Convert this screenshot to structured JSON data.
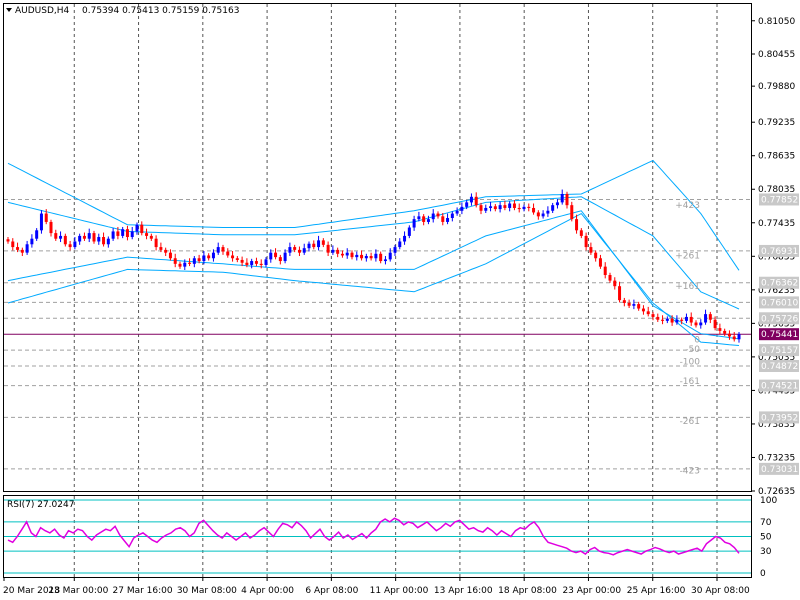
{
  "header": {
    "symbol": "AUDUSD,H4",
    "ohlc": "0.75394 0.75413 0.75159 0.75163",
    "triangle_icon": "triangle-down-icon"
  },
  "rsi": {
    "label": "RSI(7) 27.0247",
    "value": 27.0247,
    "levels": [
      "100",
      "70",
      "50",
      "30",
      "0"
    ]
  },
  "colors": {
    "bull": "#0000ff",
    "bear": "#ff0000",
    "band": "#00aaff",
    "rsi": "#e000e0",
    "rsi_level": "#00c0c0",
    "price_tag": "#800060",
    "grid": "#555555",
    "level_line": "#a0a0a0"
  },
  "chart_data": {
    "type": "candlestick",
    "ylim": [
      0.72635,
      0.8135
    ],
    "price_ticks": [
      "0.81050",
      "0.80455",
      "0.79880",
      "0.79235",
      "0.78635",
      "0.78035",
      "0.77435",
      "0.76835",
      "0.76235",
      "0.75635",
      "0.75035",
      "0.74435",
      "0.73835",
      "0.73235",
      "0.72635"
    ],
    "current_price": {
      "label": "0.75441",
      "value": 0.75441
    },
    "horizontal_levels": [
      {
        "price": 0.77852,
        "label": "0.77852",
        "fib": "+423"
      },
      {
        "price": 0.76931,
        "label": "0.76931",
        "fib": "+261"
      },
      {
        "price": 0.76362,
        "label": "0.76362",
        "fib": "+161"
      },
      {
        "price": 0.7601,
        "label": "0.76010",
        "fib": ""
      },
      {
        "price": 0.75726,
        "label": "0.75726",
        "fib": ""
      },
      {
        "price": 0.75157,
        "label": "0.75157",
        "fib": "0"
      },
      {
        "price": 0.74872,
        "label": "0.74872",
        "fib": "-50"
      },
      {
        "price": 0.74521,
        "label": "0.74521",
        "fib": "-100"
      },
      {
        "price": 0.73952,
        "label": "0.73952",
        "fib": "-261"
      },
      {
        "price": 0.73031,
        "label": "0.73031",
        "fib": "-423"
      }
    ],
    "fib_labels": [
      {
        "price": 0.7775,
        "text": "+423"
      },
      {
        "price": 0.7685,
        "text": "+261"
      },
      {
        "price": 0.763,
        "text": "+161"
      },
      {
        "price": 0.7535,
        "text": "0"
      },
      {
        "price": 0.7518,
        "text": "-50"
      },
      {
        "price": 0.7495,
        "text": "-100"
      },
      {
        "price": 0.746,
        "text": "-161"
      },
      {
        "price": 0.7389,
        "text": "-261"
      },
      {
        "price": 0.73,
        "text": "-423"
      }
    ],
    "x_labels": [
      "20 Mar 2018",
      "23 Mar 00:00",
      "27 Mar 16:00",
      "30 Mar 08:00",
      "4 Apr 00:00",
      "6 Apr 08:00",
      "11 Apr 00:00",
      "13 Apr 16:00",
      "18 Apr 08:00",
      "23 Apr 00:00",
      "25 Apr 16:00",
      "30 Apr 08:00"
    ],
    "closes": [
      0.771,
      0.77,
      0.7695,
      0.769,
      0.7705,
      0.7715,
      0.773,
      0.776,
      0.7745,
      0.7725,
      0.7715,
      0.772,
      0.7705,
      0.77,
      0.771,
      0.772,
      0.7715,
      0.7725,
      0.771,
      0.7718,
      0.7705,
      0.7715,
      0.7728,
      0.772,
      0.7732,
      0.7718,
      0.7728,
      0.774,
      0.7725,
      0.772,
      0.7715,
      0.77,
      0.7695,
      0.769,
      0.768,
      0.767,
      0.7665,
      0.7672,
      0.767,
      0.768,
      0.7675,
      0.7685,
      0.768,
      0.769,
      0.77,
      0.7692,
      0.7685,
      0.768,
      0.7677,
      0.7672,
      0.7668,
      0.7675,
      0.767,
      0.7668,
      0.7678,
      0.769,
      0.7682,
      0.7675,
      0.769,
      0.77,
      0.7695,
      0.769,
      0.7698,
      0.7706,
      0.77,
      0.7712,
      0.7704,
      0.769,
      0.7695,
      0.7688,
      0.7685,
      0.769,
      0.7682,
      0.7686,
      0.768,
      0.7684,
      0.768,
      0.7688,
      0.7675,
      0.7678,
      0.769,
      0.77,
      0.771,
      0.772,
      0.7735,
      0.775,
      0.7755,
      0.7745,
      0.775,
      0.776,
      0.7755,
      0.7745,
      0.7752,
      0.776,
      0.7765,
      0.7772,
      0.778,
      0.779,
      0.7775,
      0.7765,
      0.777,
      0.7773,
      0.7768,
      0.7775,
      0.777,
      0.7778,
      0.777,
      0.7768,
      0.7772,
      0.777,
      0.7762,
      0.7755,
      0.776,
      0.7765,
      0.7775,
      0.778,
      0.7795,
      0.7775,
      0.775,
      0.773,
      0.772,
      0.77,
      0.769,
      0.768,
      0.7665,
      0.765,
      0.764,
      0.763,
      0.7605,
      0.76,
      0.7595,
      0.7598,
      0.759,
      0.7585,
      0.758,
      0.7575,
      0.757,
      0.7568,
      0.7572,
      0.7565,
      0.757,
      0.7568,
      0.7575,
      0.7565,
      0.756,
      0.7565,
      0.758,
      0.757,
      0.7555,
      0.755,
      0.7545,
      0.754,
      0.7535,
      0.7544
    ],
    "bands": [
      {
        "name": "outer",
        "upper": [
          [
            0,
            0.785
          ],
          [
            25,
            0.774
          ],
          [
            45,
            0.7735
          ],
          [
            60,
            0.7735
          ],
          [
            85,
            0.7765
          ],
          [
            100,
            0.779
          ],
          [
            120,
            0.7795
          ],
          [
            135,
            0.7855
          ],
          [
            145,
            0.776
          ],
          [
            158,
            0.7595
          ]
        ],
        "lower": [
          [
            0,
            0.76
          ],
          [
            25,
            0.766
          ],
          [
            45,
            0.7655
          ],
          [
            60,
            0.764
          ],
          [
            85,
            0.762
          ],
          [
            100,
            0.767
          ],
          [
            120,
            0.776
          ],
          [
            135,
            0.76
          ],
          [
            145,
            0.753
          ],
          [
            158,
            0.752
          ]
        ]
      },
      {
        "name": "inner",
        "upper": [
          [
            0,
            0.778
          ],
          [
            25,
            0.7728
          ],
          [
            45,
            0.7722
          ],
          [
            60,
            0.7722
          ],
          [
            85,
            0.7745
          ],
          [
            100,
            0.778
          ],
          [
            120,
            0.779
          ],
          [
            135,
            0.772
          ],
          [
            145,
            0.762
          ],
          [
            158,
            0.757
          ]
        ],
        "lower": [
          [
            0,
            0.764
          ],
          [
            25,
            0.7682
          ],
          [
            45,
            0.767
          ],
          [
            60,
            0.766
          ],
          [
            85,
            0.766
          ],
          [
            100,
            0.772
          ],
          [
            120,
            0.7765
          ],
          [
            135,
            0.7595
          ],
          [
            145,
            0.7545
          ],
          [
            158,
            0.753
          ]
        ]
      }
    ],
    "rsi_values": [
      45,
      42,
      50,
      60,
      70,
      55,
      50,
      62,
      58,
      55,
      60,
      52,
      48,
      58,
      55,
      60,
      58,
      50,
      45,
      52,
      56,
      60,
      58,
      64,
      52,
      44,
      36,
      48,
      52,
      55,
      50,
      45,
      42,
      48,
      52,
      55,
      60,
      62,
      58,
      50,
      55,
      68,
      72,
      65,
      58,
      52,
      48,
      55,
      50,
      45,
      50,
      55,
      48,
      52,
      58,
      62,
      56,
      50,
      60,
      68,
      66,
      62,
      70,
      65,
      58,
      48,
      54,
      60,
      50,
      45,
      50,
      56,
      48,
      52,
      46,
      50,
      54,
      48,
      55,
      60,
      70,
      74,
      70,
      75,
      72,
      66,
      70,
      68,
      62,
      66,
      70,
      64,
      58,
      62,
      68,
      64,
      70,
      72,
      66,
      60,
      62,
      58,
      56,
      62,
      58,
      52,
      58,
      54,
      50,
      58,
      62,
      60,
      66,
      70,
      62,
      50,
      42,
      40,
      38,
      36,
      34,
      30,
      28,
      30,
      26,
      32,
      35,
      30,
      28,
      27,
      25,
      28,
      30,
      32,
      30,
      28,
      26,
      30,
      32,
      35,
      33,
      30,
      28,
      30,
      26,
      28,
      30,
      32,
      34,
      30,
      40,
      45,
      50,
      48,
      42,
      40,
      35,
      27
    ]
  }
}
